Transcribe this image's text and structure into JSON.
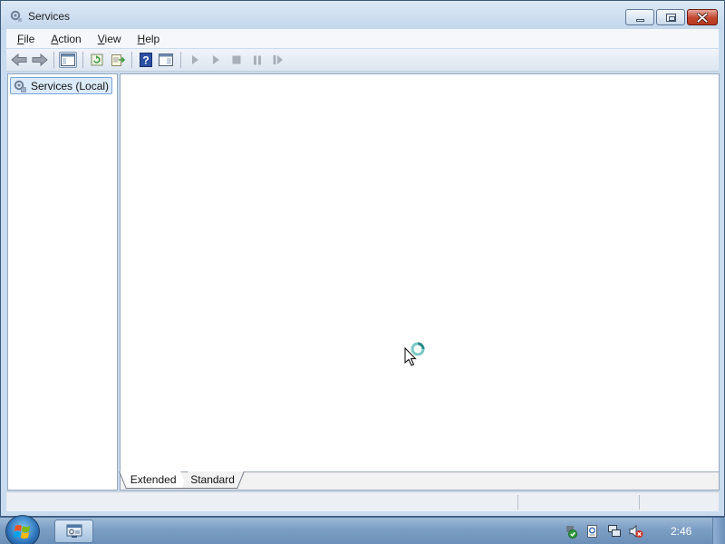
{
  "window": {
    "title": "Services",
    "controls": {
      "minimize": "minimize-icon",
      "maximize": "restore-icon",
      "close": "close-icon"
    }
  },
  "menubar": {
    "items": [
      {
        "first": "F",
        "rest": "ile"
      },
      {
        "first": "A",
        "rest": "ction"
      },
      {
        "first": "V",
        "rest": "iew"
      },
      {
        "first": "H",
        "rest": "elp"
      }
    ]
  },
  "toolbar": {
    "buttons": [
      "back-arrow-icon",
      "forward-arrow-icon",
      "show-hide-console-tree-icon",
      "refresh-icon",
      "export-list-icon",
      "help-icon",
      "show-hide-action-pane-icon",
      "start-service-icon",
      "start-service-icon",
      "stop-service-icon",
      "pause-service-icon",
      "resume-service-icon"
    ]
  },
  "tree": {
    "root_label": "Services (Local)"
  },
  "tabs": {
    "extended": "Extended",
    "standard": "Standard"
  },
  "taskbar": {
    "clock": "2:46"
  },
  "colors": {
    "accent": "#3c5a7d",
    "selection": "#dcebfa",
    "close_red": "#c2442b",
    "taskbar": "#7c9ec4"
  }
}
